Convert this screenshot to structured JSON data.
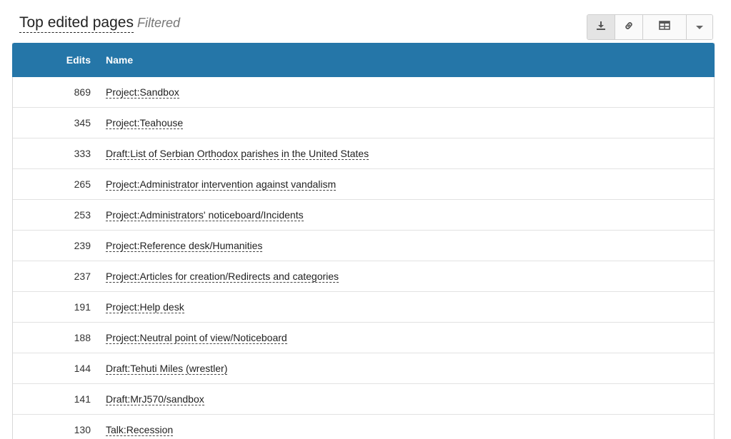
{
  "header": {
    "title": "Top edited pages",
    "subtitle": "Filtered"
  },
  "toolbar": {
    "buttons": [
      {
        "name": "download-icon"
      },
      {
        "name": "link-icon"
      },
      {
        "name": "table-icon"
      },
      {
        "name": "caret-down-icon"
      }
    ],
    "active_color": "#e4e4e4"
  },
  "table": {
    "header_color": "#2576a8",
    "columns": [
      "Edits",
      "Name"
    ],
    "rows": [
      {
        "edits": "869",
        "name": "Project:Sandbox"
      },
      {
        "edits": "345",
        "name": "Project:Teahouse"
      },
      {
        "edits": "333",
        "name": "Draft:List of Serbian Orthodox parishes in the United States"
      },
      {
        "edits": "265",
        "name": "Project:Administrator intervention against vandalism"
      },
      {
        "edits": "253",
        "name": "Project:Administrators' noticeboard/Incidents"
      },
      {
        "edits": "239",
        "name": "Project:Reference desk/Humanities"
      },
      {
        "edits": "237",
        "name": "Project:Articles for creation/Redirects and categories"
      },
      {
        "edits": "191",
        "name": "Project:Help desk"
      },
      {
        "edits": "188",
        "name": "Project:Neutral point of view/Noticeboard"
      },
      {
        "edits": "144",
        "name": "Draft:Tehuti Miles (wrestler)"
      },
      {
        "edits": "141",
        "name": "Draft:MrJ570/sandbox"
      },
      {
        "edits": "130",
        "name": "Talk:Recession"
      }
    ]
  }
}
